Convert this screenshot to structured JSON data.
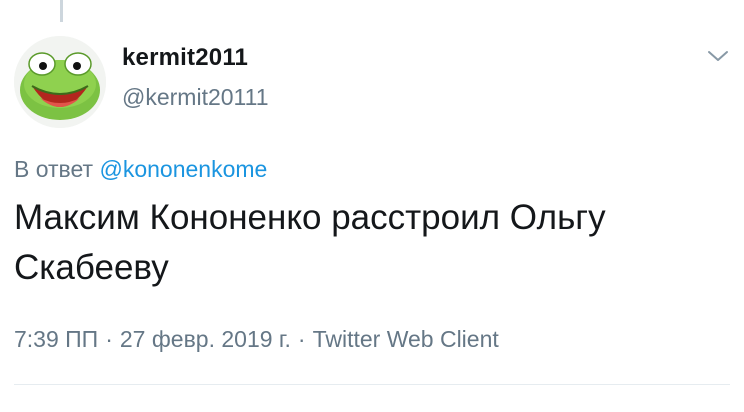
{
  "tweet": {
    "author_name": "kermit2011",
    "author_handle": "@kermit20111",
    "avatar_icon": "kermit-avatar-icon",
    "menu_icon": "chevron-down-icon",
    "reply_prefix": "В ответ",
    "reply_to": "@kononenkome",
    "text": "Максим Кононенко расстроил Ольгу Скабееву",
    "time": "7:39 ПП",
    "date": "27 февр. 2019 г.",
    "separator": "·",
    "client": "Twitter Web Client"
  },
  "colors": {
    "text": "#14171a",
    "secondary": "#657786",
    "link": "#1b95e0",
    "avatar_green": "#7cc243"
  }
}
